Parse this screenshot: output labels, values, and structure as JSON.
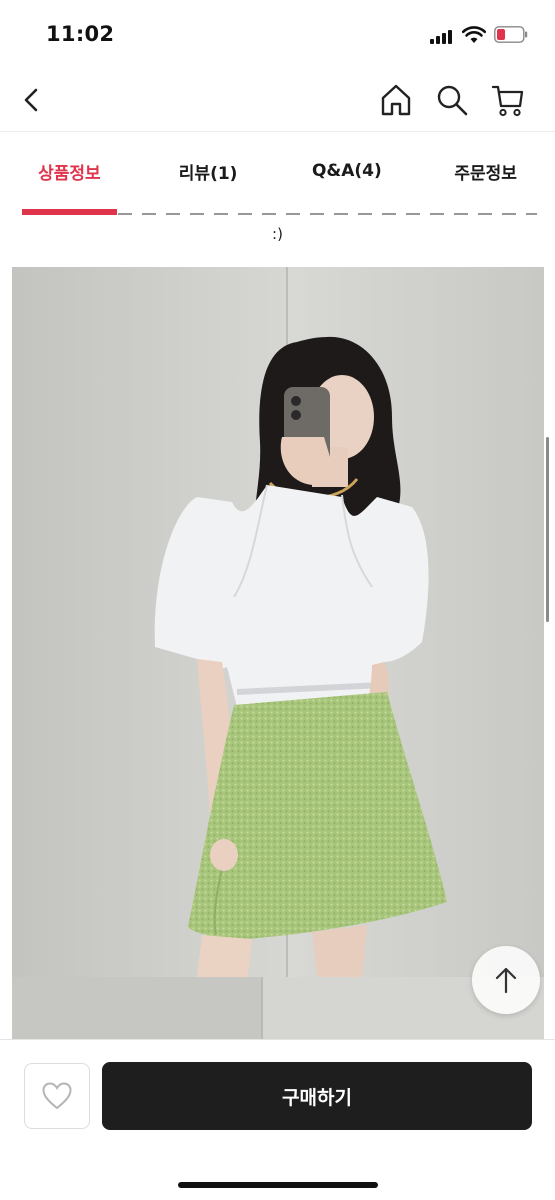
{
  "status_bar": {
    "time": "11:02",
    "icons": [
      "cellular-signal-icon",
      "wifi-icon",
      "battery-icon"
    ]
  },
  "nav": {
    "icons": [
      "back-icon",
      "home-icon",
      "search-icon",
      "cart-icon"
    ]
  },
  "tabs": [
    {
      "label": "상품정보",
      "active": true
    },
    {
      "label": "리뷰(1)",
      "active": false
    },
    {
      "label": "Q&A(4)",
      "active": false
    },
    {
      "label": "주문정보",
      "active": false
    }
  ],
  "content": {
    "description_tail": ":)",
    "product_photo": "model-mirror-selfie-white-blouse-green-tweed-skirt"
  },
  "floating": {
    "scroll_top_icon": "arrow-up-icon"
  },
  "bottom_bar": {
    "wish_icon": "heart-icon",
    "buy_label": "구매하기"
  },
  "colors": {
    "accent": "#e0344d",
    "buy_button_bg": "#1e1e1e",
    "skirt_green": "#a9c77c"
  }
}
